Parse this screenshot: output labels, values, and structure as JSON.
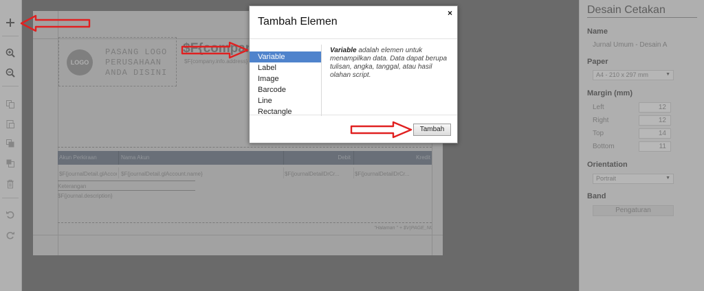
{
  "toolbar": {
    "buttons": [
      {
        "icon": "plus-icon"
      },
      {
        "icon": "zoom-in-icon"
      },
      {
        "icon": "zoom-out-icon"
      },
      {
        "icon": "copy-icon"
      },
      {
        "icon": "paste-icon"
      },
      {
        "icon": "bring-forward-icon"
      },
      {
        "icon": "send-backward-icon"
      },
      {
        "icon": "trash-icon"
      },
      {
        "icon": "undo-icon"
      },
      {
        "icon": "redo-icon"
      }
    ]
  },
  "canvas": {
    "logo_circle": "LOGO",
    "logo_text": "PASANG LOGO PERUSAHAAN ANDA DISINI",
    "company_name": "$F{company.name}",
    "company_address": "$F{company.info.address}",
    "table_headers": [
      "Akun Perkiraan",
      "Nama Akun",
      "Debit",
      "Kredit"
    ],
    "table_row": [
      "$F{journalDetail.glAccount.code}",
      "$F{journalDetail.glAccount.name}",
      "$F{journalDetailDrCr...",
      "$F{journalDetailDrCr..."
    ],
    "keterangan_label": "Keterangan",
    "keterangan_value": "$F{journal.description}",
    "page_label": "\"Halaman \" + $V{PAGE_NUMBER}"
  },
  "panel": {
    "title": "Desain Cetakan",
    "name_label": "Name",
    "name_value": "Jurnal Umum - Desain A",
    "paper_label": "Paper",
    "paper_value": "A4 - 210 x 297 mm",
    "margin_label": "Margin (mm)",
    "margins": [
      {
        "label": "Left",
        "value": "12"
      },
      {
        "label": "Right",
        "value": "12"
      },
      {
        "label": "Top",
        "value": "14"
      },
      {
        "label": "Bottom",
        "value": "11"
      }
    ],
    "orientation_label": "Orientation",
    "orientation_value": "Portrait",
    "band_label": "Band",
    "band_button": "Pengaturan"
  },
  "modal": {
    "title": "Tambah Elemen",
    "close": "×",
    "items": [
      "Variable",
      "Label",
      "Image",
      "Barcode",
      "Line",
      "Rectangle"
    ],
    "selected": "Variable",
    "desc_bold": "Variable",
    "desc_rest": " adalah elemen untuk menampilkan data. Data dapat berupa tulisan, angka, tanggal, atau hasil olahan script.",
    "add_button": "Tambah"
  },
  "colors": {
    "selection": "#4f83cc",
    "annotation_arrow": "#e02020",
    "table_header_bg": "#7f8895"
  }
}
